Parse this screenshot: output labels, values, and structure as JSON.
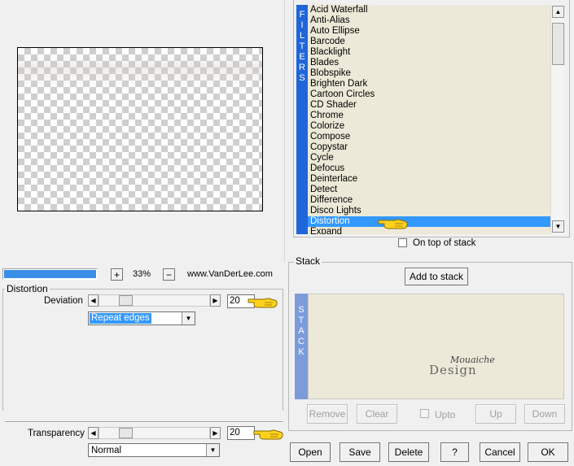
{
  "preview": {
    "zoom": "33%",
    "plus": "+",
    "minus": "−",
    "site": "www.VanDerLee.com"
  },
  "filters": {
    "vertical_label": [
      "F",
      "I",
      "L",
      "T",
      "E",
      "R",
      "S"
    ],
    "items": [
      "Acid Waterfall",
      "Anti-Alias",
      "Auto Ellipse",
      "Barcode",
      "Blacklight",
      "Blades",
      "Blobspike",
      "Brighten Dark",
      "Cartoon Circles",
      "CD Shader",
      "Chrome",
      "Colorize",
      "Compose",
      "Copystar",
      "Cycle",
      "Defocus",
      "Deinterlace",
      "Detect",
      "Difference",
      "Disco Lights",
      "Distortion",
      "Expand"
    ],
    "selected": "Distortion",
    "on_top_label": "On top of stack",
    "on_top_checked": false
  },
  "stack": {
    "group_label": "Stack",
    "add_label": "Add to stack",
    "vertical_label": [
      "S",
      "T",
      "A",
      "C",
      "K"
    ],
    "remove_label": "Remove",
    "clear_label": "Clear",
    "upto_label": "Upto",
    "up_label": "Up",
    "down_label": "Down",
    "watermark_line1": "Design",
    "watermark_line2": "Mouaiche"
  },
  "distortion": {
    "group_label": "Distortion",
    "deviation_label": "Deviation",
    "deviation_value": "20",
    "deviation_level": 0.2,
    "edges_value": "Repeat edges"
  },
  "transparency": {
    "label": "Transparency",
    "value": "20",
    "level": 0.2,
    "mode": "Normal"
  },
  "footer": {
    "open": "Open",
    "save": "Save",
    "delete": "Delete",
    "help": "?",
    "cancel": "Cancel",
    "ok": "OK"
  }
}
